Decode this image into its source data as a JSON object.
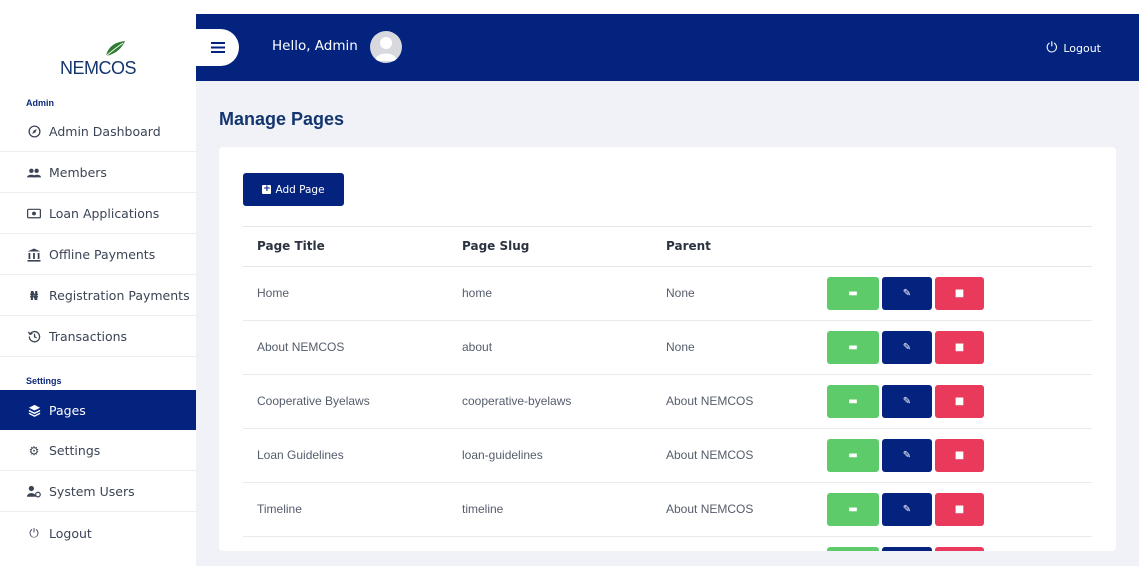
{
  "brand": {
    "logo_text": "NEMCOS"
  },
  "sidebar": {
    "section_admin": "Admin",
    "section_settings": "Settings",
    "items": [
      {
        "label": "Admin Dashboard",
        "icon": "compass-icon"
      },
      {
        "label": "Members",
        "icon": "users-icon"
      },
      {
        "label": "Loan Applications",
        "icon": "money-bill-icon"
      },
      {
        "label": "Offline Payments",
        "icon": "bank-icon"
      },
      {
        "label": "Registration Payments",
        "icon": "naira-icon"
      },
      {
        "label": "Transactions",
        "icon": "history-icon"
      },
      {
        "label": "Pages",
        "icon": "layers-icon",
        "active": true
      },
      {
        "label": "Settings",
        "icon": "gear-icon"
      },
      {
        "label": "System Users",
        "icon": "user-gear-icon"
      },
      {
        "label": "Logout",
        "icon": "power-icon"
      }
    ]
  },
  "topbar": {
    "greeting": "Hello, Admin",
    "logout": "Logout"
  },
  "main": {
    "title": "Manage Pages",
    "add_button": "Add Page",
    "table": {
      "headers": [
        "Page Title",
        "Page Slug",
        "Parent"
      ],
      "rows": [
        [
          "Home",
          "home",
          "None"
        ],
        [
          "About NEMCOS",
          "about",
          "None"
        ],
        [
          "Cooperative Byelaws",
          "cooperative-byelaws",
          "About NEMCOS"
        ],
        [
          "Loan Guidelines",
          "loan-guidelines",
          "About NEMCOS"
        ],
        [
          "Timeline",
          "timeline",
          "About NEMCOS"
        ]
      ]
    }
  },
  "colors": {
    "primary": "#04237f",
    "view": "#5ecb6a",
    "delete": "#ea3a5c",
    "background": "#f1f2f7"
  }
}
